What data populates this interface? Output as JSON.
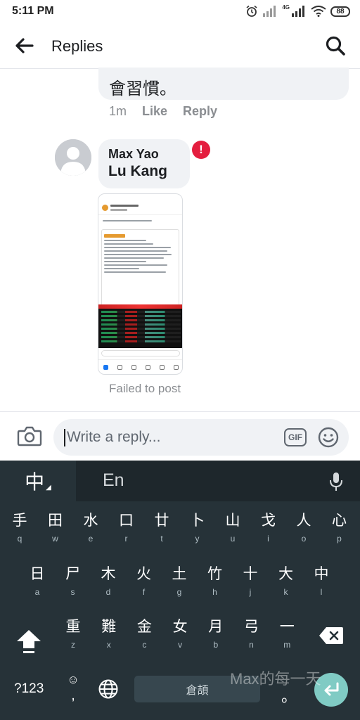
{
  "status_bar": {
    "time": "5:11 PM",
    "network": "4G",
    "battery": "88"
  },
  "header": {
    "title": "Replies"
  },
  "previous_comment": {
    "text": "會習慣。",
    "time": "1m",
    "like_label": "Like",
    "reply_label": "Reply"
  },
  "reply": {
    "author": "Max Yao",
    "text": "Lu Kang",
    "error_icon": "!",
    "status": "Failed to post"
  },
  "composer": {
    "placeholder": "Write a reply...",
    "gif_label": "GIF"
  },
  "keyboard": {
    "lang_zh": "中",
    "lang_en": "En",
    "row1": [
      {
        "main": "手",
        "sub": "q"
      },
      {
        "main": "田",
        "sub": "w"
      },
      {
        "main": "水",
        "sub": "e"
      },
      {
        "main": "口",
        "sub": "r"
      },
      {
        "main": "廿",
        "sub": "t"
      },
      {
        "main": "卜",
        "sub": "y"
      },
      {
        "main": "山",
        "sub": "u"
      },
      {
        "main": "戈",
        "sub": "i"
      },
      {
        "main": "人",
        "sub": "o"
      },
      {
        "main": "心",
        "sub": "p"
      }
    ],
    "row2": [
      {
        "main": "日",
        "sub": "a"
      },
      {
        "main": "尸",
        "sub": "s"
      },
      {
        "main": "木",
        "sub": "d"
      },
      {
        "main": "火",
        "sub": "f"
      },
      {
        "main": "土",
        "sub": "g"
      },
      {
        "main": "竹",
        "sub": "h"
      },
      {
        "main": "十",
        "sub": "j"
      },
      {
        "main": "大",
        "sub": "k"
      },
      {
        "main": "中",
        "sub": "l"
      }
    ],
    "row3": [
      {
        "main": "重",
        "sub": "z"
      },
      {
        "main": "難",
        "sub": "x"
      },
      {
        "main": "金",
        "sub": "c"
      },
      {
        "main": "女",
        "sub": "v"
      },
      {
        "main": "月",
        "sub": "b"
      },
      {
        "main": "弓",
        "sub": "n"
      },
      {
        "main": "一",
        "sub": "m"
      }
    ],
    "symbols_label": "?123",
    "emoji_label": "☺",
    "comma_label": ",",
    "space_label": "倉頡",
    "period_label": "。"
  },
  "watermark": "Max的每一天"
}
